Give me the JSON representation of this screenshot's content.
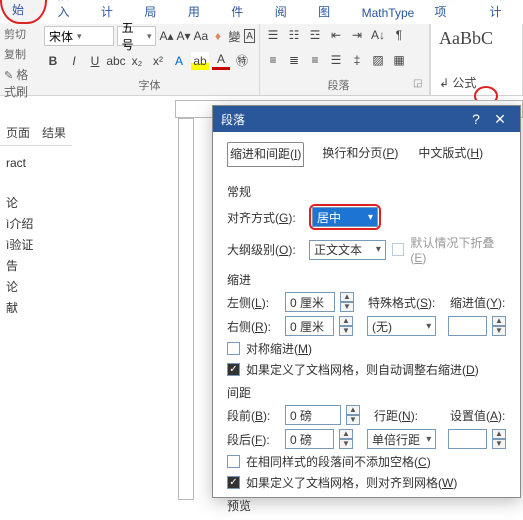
{
  "tabs": {
    "start": "开始",
    "insert": "插入",
    "design": "设计",
    "layout": "布局",
    "reference": "引用",
    "mail": "邮件",
    "review": "审阅",
    "view": "视图",
    "mathtype": "MathType",
    "addins": "加载项",
    "design2": "设计"
  },
  "quick": {
    "cut": "剪切",
    "copy": "复制",
    "painter": "格式刷"
  },
  "font": {
    "name": "宋体",
    "size": "五号"
  },
  "groups": {
    "font": "字体",
    "paragraph": "段落"
  },
  "styles": {
    "preview": "AaBbC",
    "formula": "公式"
  },
  "side": {
    "tab_page": "页面",
    "tab_result": "结果",
    "items": [
      "ract",
      "",
      "论",
      "绍",
      "证",
      "告",
      "论",
      "献"
    ],
    "items_full": [
      "",
      "",
      "论",
      "介绍",
      "验证",
      "告",
      "论",
      "献"
    ]
  },
  "ruler_corner": "L",
  "dlg": {
    "title": "段落",
    "tabs": {
      "indent": "缩进和间距",
      "linebreak": "换行和分页",
      "cjk": "中文版式",
      "indent_k": "I",
      "linebreak_k": "P",
      "cjk_k": "H"
    },
    "general": "常规",
    "align_lbl": "对齐方式",
    "align_k": "G",
    "align_val": "居中",
    "outline_lbl": "大纲级别",
    "outline_k": "O",
    "outline_val": "正文文本",
    "collapse_lbl": "默认情况下折叠",
    "collapse_k": "E",
    "indent_h": "缩进",
    "left_lbl": "左侧",
    "left_k": "L",
    "left_val": "0 厘米",
    "right_lbl": "右侧",
    "right_k": "R",
    "right_val": "0 厘米",
    "special_lbl": "特殊格式",
    "special_k": "S",
    "special_val": "(无)",
    "indentval_lbl": "缩进值",
    "indentval_k": "Y",
    "sym_lbl": "对称缩进",
    "sym_k": "M",
    "autogrid_lbl": "如果定义了文档网格，则自动调整右缩进",
    "autogrid_k": "D",
    "spacing_h": "间距",
    "before_lbl": "段前",
    "before_k": "B",
    "before_val": "0 磅",
    "after_lbl": "段后",
    "after_k": "F",
    "after_val": "0 磅",
    "linesp_lbl": "行距",
    "linesp_k": "N",
    "linesp_val": "单倍行距",
    "setval_lbl": "设置值",
    "setval_k": "A",
    "nospace_lbl": "在相同样式的段落间不添加空格",
    "nospace_k": "C",
    "snapgrid_lbl": "如果定义了文档网格，则对齐到网格",
    "snapgrid_k": "W",
    "preview_h": "预览"
  }
}
